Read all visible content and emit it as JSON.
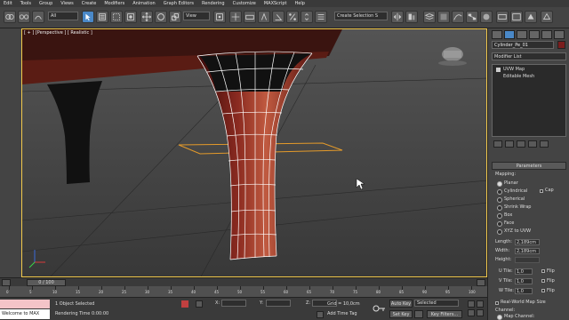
{
  "menu": [
    "Edit",
    "Tools",
    "Group",
    "Views",
    "Create",
    "Modifiers",
    "Animation",
    "Graph Editors",
    "Rendering",
    "Customize",
    "MAXScript",
    "Help"
  ],
  "toolbar": {
    "selection_filter": "All",
    "ref_coord": "View",
    "named_selection": "Create Selection S"
  },
  "viewport": {
    "label": "[ + ] [Perspective ] [ Realistic ]"
  },
  "command_panel": {
    "object_name": "Cylinder_Pe_01",
    "modifier_list": "Modifier List",
    "stack": [
      "UVW Map",
      "Editable Mesh"
    ],
    "parameters_title": "Parameters",
    "mapping_label": "Mapping:",
    "mapping_options": [
      "Planar",
      "Cylindrical",
      "Spherical",
      "Shrink Wrap",
      "Box",
      "Face",
      "XYZ to UVW"
    ],
    "cap_label": "Cap",
    "length_label": "Length:",
    "length_value": "2,189cm",
    "width_label": "Width:",
    "width_value": "2,189cm",
    "height_label": "Height:",
    "utile_label": "U Tile:",
    "utile_value": "1,0",
    "vtile_label": "V Tile:",
    "vtile_value": "1,0",
    "wtile_label": "W Tile:",
    "wtile_value": "1,0",
    "flip_label": "Flip",
    "realworld_label": "Real-World Map Size",
    "channel_label": "Channel:",
    "map_channel_label": "Map Channel:"
  },
  "timeline": {
    "frame": "0 / 100",
    "ticks": [
      "0",
      "5",
      "10",
      "15",
      "20",
      "25",
      "30",
      "35",
      "40",
      "45",
      "50",
      "55",
      "60",
      "65",
      "70",
      "75",
      "80",
      "85",
      "90",
      "95",
      "100"
    ]
  },
  "status": {
    "maxscript": "Welcome to MAX",
    "selected": "1 Object Selected",
    "render_time": "Rendering Time 0:00:00",
    "x_label": "X:",
    "y_label": "Y:",
    "z_label": "Z:",
    "grid": "Grid = 10,0cm",
    "add_time_tag": "Add Time Tag",
    "auto_key": "Auto Key",
    "set_key": "Set Key",
    "selected_dropdown": "Selected",
    "key_filters": "Key Filters..."
  }
}
